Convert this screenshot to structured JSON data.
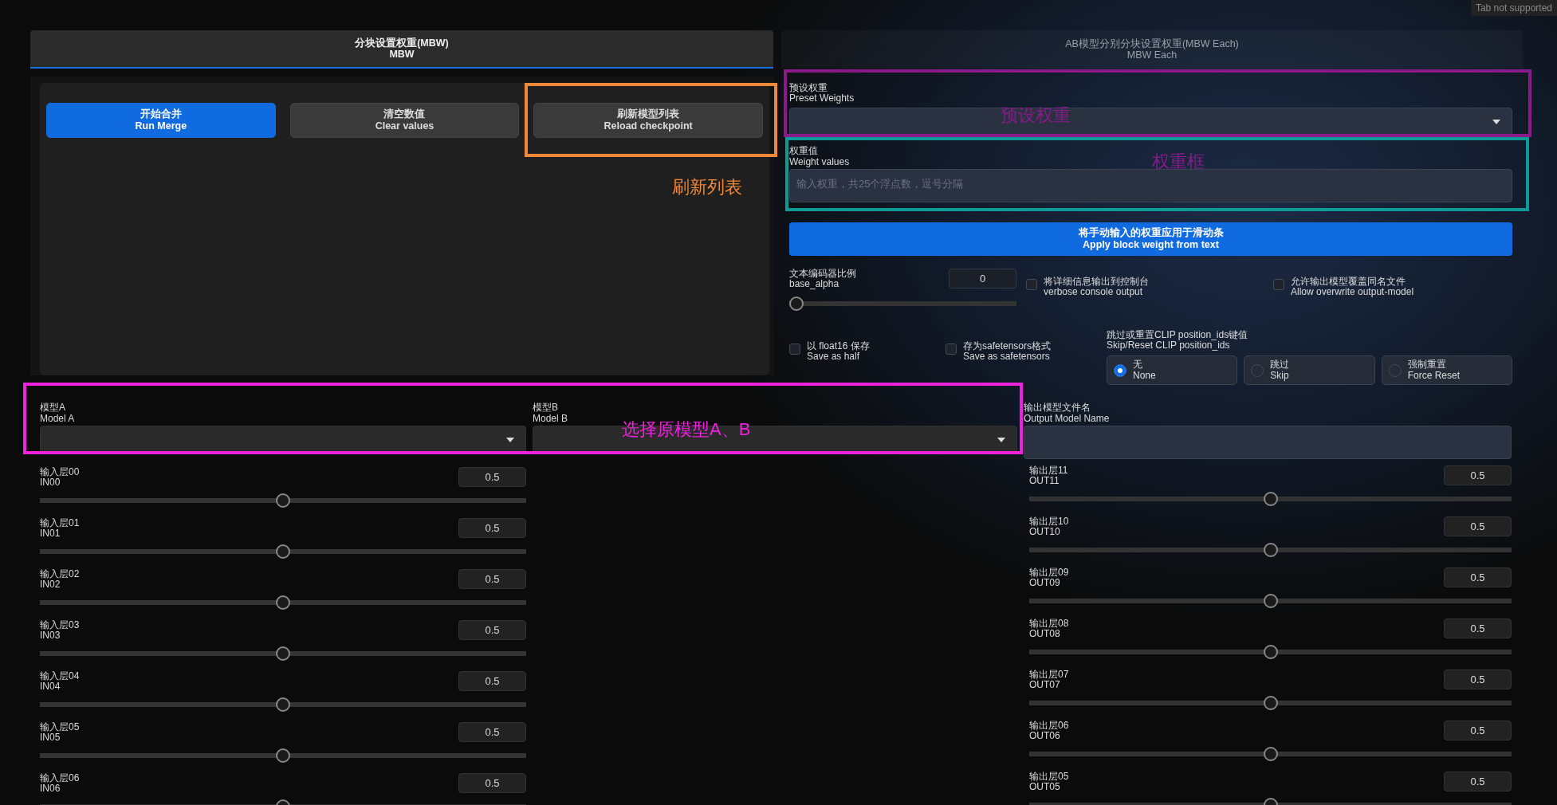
{
  "corner_badge": "Tab not supported",
  "tabs": [
    {
      "title": "分块设置权重(MBW)",
      "subtitle": "MBW",
      "selected": true
    },
    {
      "title": "AB模型分别分块设置权重(MBW Each)",
      "subtitle": "MBW Each",
      "selected": false
    }
  ],
  "buttons": [
    {
      "title": "开始合并",
      "subtitle": "Run Merge",
      "kind": "primary"
    },
    {
      "title": "清空数值",
      "subtitle": "Clear values",
      "kind": "secondary"
    },
    {
      "title": "刷新模型列表",
      "subtitle": "Reload checkpoint",
      "kind": "secondary"
    }
  ],
  "preset_weights": {
    "label": "预设权重",
    "sublabel": "Preset Weights"
  },
  "weight_values": {
    "label": "权重值",
    "sublabel": "Weight values",
    "placeholder": "输入权重，共25个浮点数，逗号分隔"
  },
  "apply_button": {
    "title": "将手动输入的权重应用于滑动条",
    "subtitle": "Apply block weight from text"
  },
  "base_alpha": {
    "label": "文本编码器比例",
    "sublabel": "base_alpha",
    "value": "0",
    "level": 0
  },
  "checkboxes": [
    {
      "label": "将详细信息输出到控制台",
      "sublabel": "verbose console output",
      "checked": false
    },
    {
      "label": "允许输出模型覆盖同名文件",
      "sublabel": "Allow overwrite output-model",
      "checked": false
    },
    {
      "label": "以 float16 保存",
      "sublabel": "Save as half",
      "checked": false
    },
    {
      "label": "存为safetensors格式",
      "sublabel": "Save as safetensors",
      "checked": false
    }
  ],
  "clip_reset": {
    "label": "跳过或重置CLIP position_ids键值",
    "sublabel": "Skip/Reset CLIP position_ids",
    "options": [
      {
        "label": "无",
        "sublabel": "None",
        "selected": true
      },
      {
        "label": "跳过",
        "sublabel": "Skip",
        "selected": false
      },
      {
        "label": "强制重置",
        "sublabel": "Force Reset",
        "selected": false
      }
    ]
  },
  "model_a": {
    "label": "模型A",
    "sublabel": "Model A"
  },
  "model_b": {
    "label": "模型B",
    "sublabel": "Model B"
  },
  "output_name": {
    "label": "输出模型文件名",
    "sublabel": "Output Model Name"
  },
  "in_sliders": [
    {
      "label": "输入层00",
      "sublabel": "IN00",
      "value": "0.5",
      "level": 0.5
    },
    {
      "label": "输入层01",
      "sublabel": "IN01",
      "value": "0.5",
      "level": 0.5
    },
    {
      "label": "输入层02",
      "sublabel": "IN02",
      "value": "0.5",
      "level": 0.5
    },
    {
      "label": "输入层03",
      "sublabel": "IN03",
      "value": "0.5",
      "level": 0.5
    },
    {
      "label": "输入层04",
      "sublabel": "IN04",
      "value": "0.5",
      "level": 0.5
    },
    {
      "label": "输入层05",
      "sublabel": "IN05",
      "value": "0.5",
      "level": 0.5
    },
    {
      "label": "输入层06",
      "sublabel": "IN06",
      "value": "0.5",
      "level": 0.5
    }
  ],
  "out_sliders": [
    {
      "label": "输出层11",
      "sublabel": "OUT11",
      "value": "0.5",
      "level": 0.5
    },
    {
      "label": "输出层10",
      "sublabel": "OUT10",
      "value": "0.5",
      "level": 0.5
    },
    {
      "label": "输出层09",
      "sublabel": "OUT09",
      "value": "0.5",
      "level": 0.5
    },
    {
      "label": "输出层08",
      "sublabel": "OUT08",
      "value": "0.5",
      "level": 0.5
    },
    {
      "label": "输出层07",
      "sublabel": "OUT07",
      "value": "0.5",
      "level": 0.5
    },
    {
      "label": "输出层06",
      "sublabel": "OUT06",
      "value": "0.5",
      "level": 0.5
    },
    {
      "label": "输出层05",
      "sublabel": "OUT05",
      "value": "0.5",
      "level": 0.5
    }
  ],
  "annotation_frames": [
    {
      "color": "#f0883a"
    },
    {
      "color": "#8a1a8a"
    },
    {
      "color": "#0e9a96"
    },
    {
      "color": "#ee22dd"
    }
  ],
  "annotation_labels": [
    {
      "text": "刷新列表",
      "color": "#f0883a"
    },
    {
      "text": "预设权重",
      "color": "#8a1a8a"
    },
    {
      "text": "权重框",
      "color": "#8a1a8a"
    },
    {
      "text": "选择原模型A、B",
      "color": "#ee22dd"
    }
  ]
}
